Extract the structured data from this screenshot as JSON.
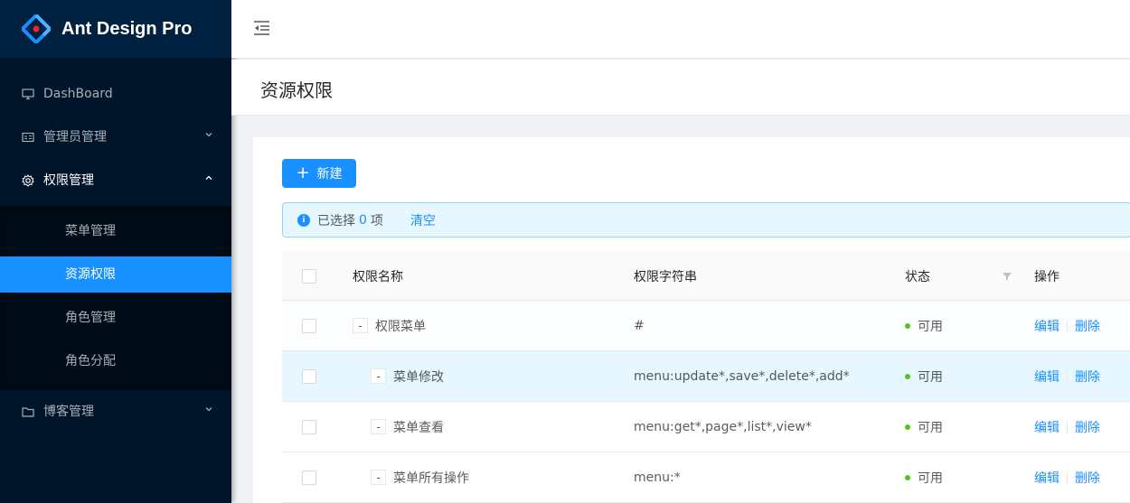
{
  "app": {
    "title": "Ant Design Pro"
  },
  "colors": {
    "primary": "#1890ff",
    "sider_bg": "#001529",
    "success": "#52c41a"
  },
  "sidebar": {
    "items": [
      {
        "label": "DashBoard",
        "icon": "desktop-icon"
      },
      {
        "label": "管理员管理",
        "icon": "idcard-icon",
        "arrow": "chevron-down-icon"
      },
      {
        "label": "权限管理",
        "icon": "setting-icon",
        "arrow": "chevron-up-icon",
        "open": true,
        "children": [
          {
            "label": "菜单管理"
          },
          {
            "label": "资源权限",
            "selected": true
          },
          {
            "label": "角色管理"
          },
          {
            "label": "角色分配"
          }
        ]
      },
      {
        "label": "博客管理",
        "icon": "folder-icon",
        "arrow": "chevron-down-icon"
      }
    ]
  },
  "header": {
    "trigger_icon": "menu-fold-icon"
  },
  "page": {
    "title": "资源权限"
  },
  "toolbar": {
    "new_label": "新建",
    "new_icon": "plus-icon"
  },
  "alert": {
    "prefix": "已选择",
    "count": "0",
    "suffix": "项",
    "clear_label": "清空",
    "icon": "info-circle-icon"
  },
  "table": {
    "columns": [
      "权限名称",
      "权限字符串",
      "状态",
      "操作"
    ],
    "rows": [
      {
        "expand": "-",
        "name": "权限菜单",
        "perm": "#",
        "status": "可用",
        "edit": "编辑",
        "delete": "删除"
      },
      {
        "expand": "-",
        "name": "菜单修改",
        "perm": "menu:update*,save*,delete*,add*",
        "status": "可用",
        "edit": "编辑",
        "delete": "删除"
      },
      {
        "expand": "-",
        "name": "菜单查看",
        "perm": "menu:get*,page*,list*,view*",
        "status": "可用",
        "edit": "编辑",
        "delete": "删除"
      },
      {
        "expand": "-",
        "name": "菜单所有操作",
        "perm": "menu:*",
        "status": "可用",
        "edit": "编辑",
        "delete": "删除"
      }
    ]
  }
}
